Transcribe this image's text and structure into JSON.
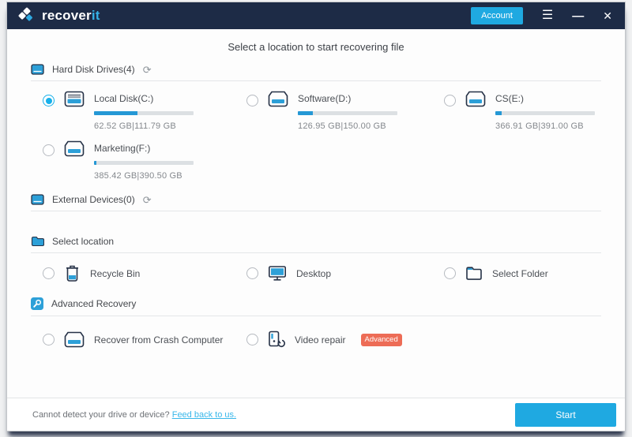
{
  "window": {
    "titlebar": {
      "brand_primary": "recover",
      "brand_accent": "it",
      "account_label": "Account",
      "menu_glyph": "☰",
      "minimize_glyph": "—",
      "close_glyph": "✕"
    },
    "title": "Select a location to start recovering file",
    "sections": {
      "hard_disk": {
        "label": "Hard Disk Drives(4)",
        "refresh_glyph": "⟳"
      },
      "external": {
        "label": "External Devices(0)",
        "refresh_glyph": "⟳"
      },
      "location": {
        "label": "Select location"
      },
      "advanced": {
        "label": "Advanced Recovery"
      }
    },
    "drives": [
      {
        "name": "Local Disk(C:)",
        "capacity": "62.52 GB|111.79 GB",
        "used_percent": 44,
        "selected": true
      },
      {
        "name": "Software(D:)",
        "capacity": "126.95 GB|150.00 GB",
        "used_percent": 15,
        "selected": false
      },
      {
        "name": "CS(E:)",
        "capacity": "366.91 GB|391.00 GB",
        "used_percent": 6,
        "selected": false
      },
      {
        "name": "Marketing(F:)",
        "capacity": "385.42 GB|390.50 GB",
        "used_percent": 2,
        "selected": false
      }
    ],
    "locations": [
      {
        "label": "Recycle Bin"
      },
      {
        "label": "Desktop"
      },
      {
        "label": "Select Folder"
      }
    ],
    "advanced_items": [
      {
        "label": "Recover from Crash Computer"
      },
      {
        "label": "Video repair",
        "badge": "Advanced"
      }
    ],
    "footer": {
      "question": "Cannot detect your drive or device? ",
      "link_label": "Feed back to us.",
      "start_label": "Start"
    },
    "colors": {
      "accent": "#1fa9e1",
      "titlebar_bg": "#1d2b46",
      "badge_bg": "#ed6c56",
      "bar_fill": "#2598d5",
      "bar_track": "#dce0e3"
    }
  }
}
